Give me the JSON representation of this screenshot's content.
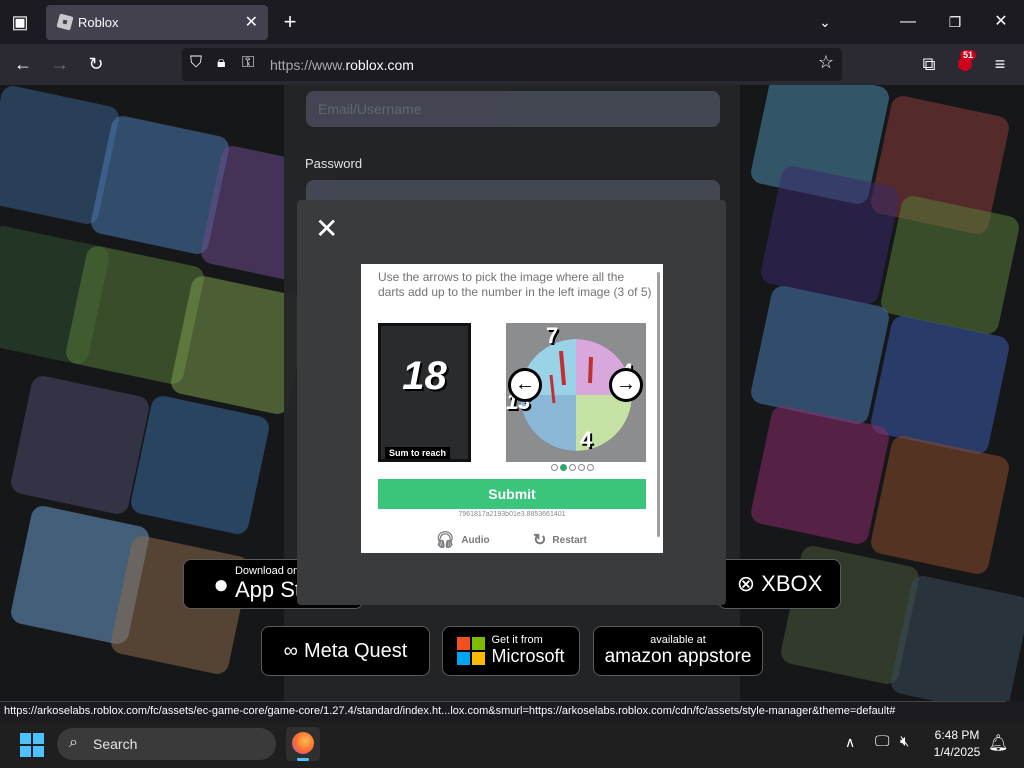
{
  "browser": {
    "tab_title": "Roblox",
    "tab_close": "✕",
    "new_tab": "+",
    "url_prefix": "https://www.",
    "url_domain": "roblox.com",
    "extension_badge": "51"
  },
  "login": {
    "username_placeholder": "Email/Username",
    "password_label": "Password"
  },
  "captcha": {
    "instructions": "Use the arrows to pick the image where all the darts add up to the number in the left image (3 of 5)",
    "target_number": "18",
    "target_caption": "Sum to reach",
    "dart_numbers": [
      "7",
      "4",
      "13",
      "4"
    ],
    "submit_label": "Submit",
    "session_id": "7961817a2193b01e3.8853661401",
    "audio_label": "Audio",
    "restart_label": "Restart",
    "progress_total": 5,
    "progress_active_index": 1
  },
  "stores": {
    "app_store_small": "Download on the",
    "app_store_big": "App Store",
    "xbox": "XBOX",
    "meta_quest": "Meta Quest",
    "microsoft_small": "Get it from",
    "microsoft_big": "Microsoft",
    "amazon_small": "available at",
    "amazon_big": "amazon appstore"
  },
  "status_url": "https://arkoselabs.roblox.com/fc/assets/ec-game-core/game-core/1.27.4/standard/index.ht...lox.com&smurl=https://arkoselabs.roblox.com/cdn/fc/assets/style-manager&theme=default#",
  "taskbar": {
    "search_label": "Search",
    "time": "6:48 PM",
    "date": "1/4/2025"
  },
  "colors": {
    "submit": "#3bc57b",
    "dot_active": "#2ea86b",
    "badge": "#d0021b"
  }
}
